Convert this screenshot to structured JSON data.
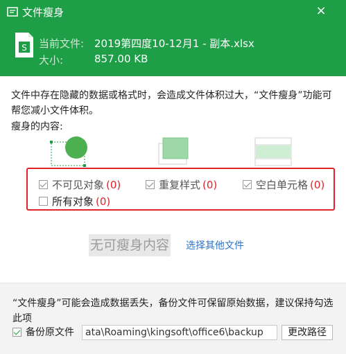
{
  "window": {
    "title": "文件瘦身",
    "close_glyph": "×"
  },
  "file": {
    "name_label": "当前文件:",
    "name_value": "2019第四度10-12月1 - 副本.xlsx",
    "size_label": "大小:",
    "size_value": "857.00 KB"
  },
  "description": "文件中存在隐藏的数据或格式时，会造成文件体积过大，“文件瘦身”功能可帮您减小文件体积。",
  "content_label": "瘦身的内容:",
  "options": [
    {
      "label": "不可见对象",
      "count": "(0)",
      "checked": true
    },
    {
      "label": "重复样式",
      "count": "(0)",
      "checked": true
    },
    {
      "label": "空白单元格",
      "count": "(0)",
      "checked": true
    },
    {
      "label": "所有对象",
      "count": "(0)",
      "checked": false
    }
  ],
  "status": {
    "no_content": "无可瘦身内容",
    "select_other": "选择其他文件"
  },
  "footer": {
    "warning": "“文件瘦身”可能会造成数据丢失，备份文件可保留原始数据，建议保持勾选此项",
    "backup_label": "备份原文件",
    "backup_checked": true,
    "backup_path": "ata\\Roaming\\kingsoft\\office6\\backup",
    "change_path_button": "更改路径"
  },
  "colors": {
    "header_green": "#1e9e47",
    "count_red": "#e0222a",
    "link_blue": "#2b74c7"
  }
}
